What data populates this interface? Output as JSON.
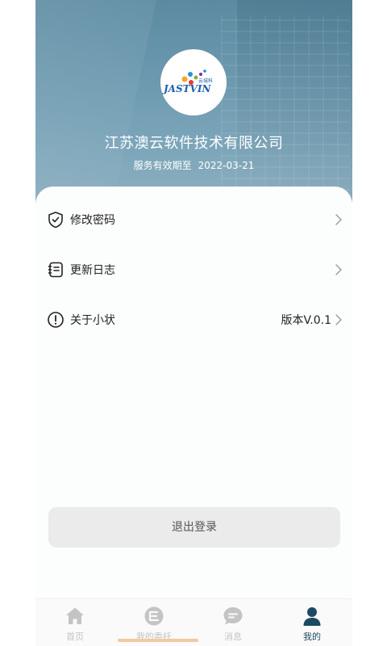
{
  "header": {
    "logo_text": "JASTVIN",
    "logo_sub": "云城科",
    "company_name": "江苏澳云软件技术有限公司",
    "expiry_label": "服务有效期至",
    "expiry_date": "2022-03-21"
  },
  "menu": [
    {
      "label": "修改密码",
      "icon": "shield-check-icon"
    },
    {
      "label": "更新日志",
      "icon": "notebook-icon"
    },
    {
      "label": "关于小状",
      "icon": "exclamation-circle-icon",
      "value": "版本V.0.1"
    }
  ],
  "logout_label": "退出登录",
  "tabbar": {
    "tabs": [
      {
        "label": "首页",
        "icon": "home-icon"
      },
      {
        "label": "我的委托",
        "icon": "entrust-icon"
      },
      {
        "label": "消息",
        "icon": "message-icon"
      },
      {
        "label": "我的",
        "icon": "user-icon"
      }
    ],
    "active_index": 3,
    "active_color": "#1d4a63",
    "inactive_color": "#c4c4c4"
  }
}
